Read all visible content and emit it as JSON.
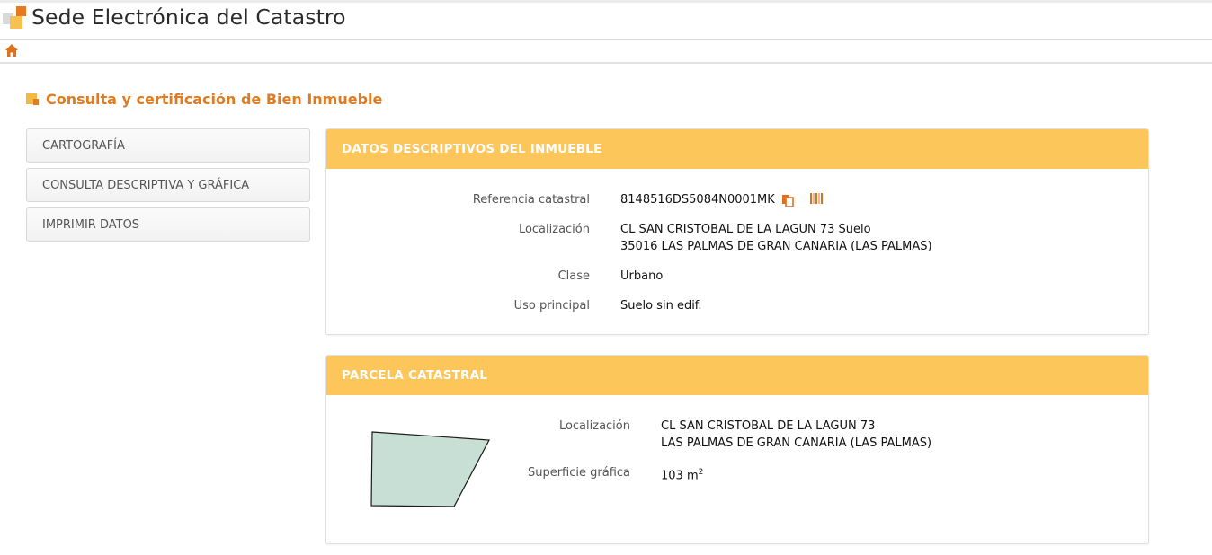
{
  "header": {
    "site_title": "Sede Electrónica del Catastro"
  },
  "breadcrumb": {
    "home_icon": "home-icon"
  },
  "page": {
    "title": "Consulta y certificación de Bien Inmueble"
  },
  "sidebar": {
    "items": [
      {
        "label": "CARTOGRAFÍA"
      },
      {
        "label": "CONSULTA DESCRIPTIVA Y GRÁFICA"
      },
      {
        "label": "IMPRIMIR DATOS"
      }
    ]
  },
  "datos": {
    "title": "DATOS DESCRIPTIVOS DEL INMUEBLE",
    "ref_label": "Referencia catastral",
    "ref_value": "8148516DS5084N0001MK",
    "loc_label": "Localización",
    "loc_line1": "CL SAN CRISTOBAL DE LA LAGUN 73 Suelo",
    "loc_line2": "35016 LAS PALMAS DE GRAN CANARIA (LAS PALMAS)",
    "clase_label": "Clase",
    "clase_value": "Urbano",
    "uso_label": "Uso principal",
    "uso_value": "Suelo sin edif."
  },
  "parcela": {
    "title": "PARCELA CATASTRAL",
    "loc_label": "Localización",
    "loc_line1": "CL SAN CRISTOBAL DE LA LAGUN 73",
    "loc_line2": "LAS PALMAS DE GRAN CANARIA (LAS PALMAS)",
    "sup_label": "Superficie gráfica",
    "sup_value": "103 m",
    "sup_exp": "2"
  },
  "colors": {
    "accent": "#e07b20",
    "panel_header": "#fdc65a",
    "parcel_fill": "#c8dfd6"
  }
}
